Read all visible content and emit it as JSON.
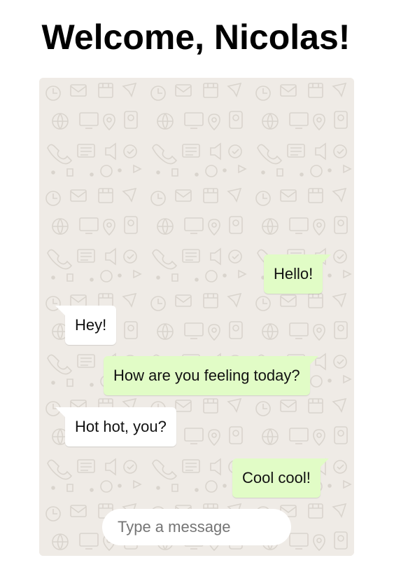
{
  "page": {
    "title": "Welcome, Nicolas!"
  },
  "chat": {
    "messages": [
      {
        "text": "Hello!",
        "direction": "outgoing"
      },
      {
        "text": "Hey!",
        "direction": "incoming"
      },
      {
        "text": "How are you feeling today?",
        "direction": "outgoing"
      },
      {
        "text": "Hot hot, you?",
        "direction": "incoming"
      },
      {
        "text": "Cool cool!",
        "direction": "outgoing"
      }
    ],
    "input": {
      "placeholder": "Type a message",
      "value": ""
    }
  },
  "colors": {
    "chat_background": "#efebe6",
    "outgoing_bubble": "#e1fcc6",
    "incoming_bubble": "#ffffff"
  }
}
